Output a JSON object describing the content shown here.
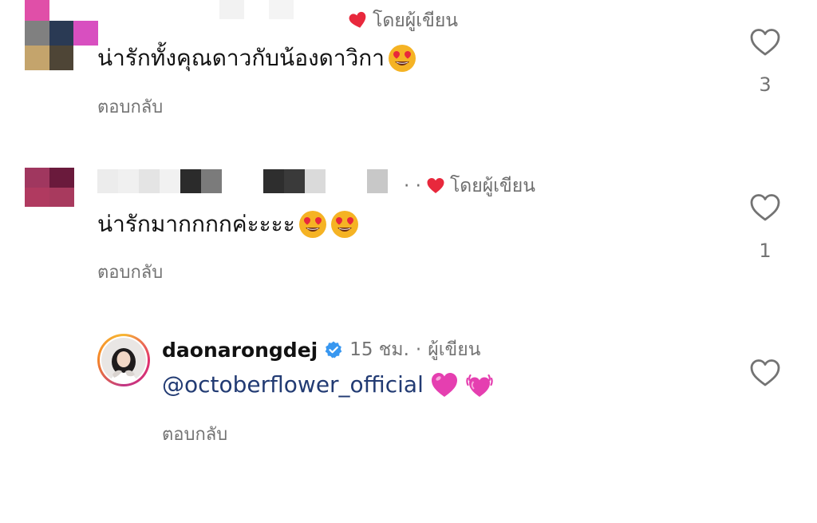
{
  "comments": [
    {
      "avatar_pixels": [
        "#e04fa8",
        "#ffffff",
        "#ffffff",
        "#808080",
        "#2a3a54",
        "#d84fc0",
        "#c4a46c",
        "#4e4536",
        "#ffffff"
      ],
      "name_pixels": [
        "#f2f2f2",
        "#ffffff",
        "#f4f4f4"
      ],
      "liked_by_author": "โดยผู้เขียน",
      "text": "น่ารักทั้งคุณดาวกับน้องดาวิกา",
      "emojis": [
        "heart-eyes"
      ],
      "reply_label": "ตอบกลับ",
      "like_count": "3"
    },
    {
      "avatar_pixels": [
        "#a0375f",
        "#6a1a3c",
        "#b03a60",
        "#a83a5e",
        "#ffffff",
        "#ffffff"
      ],
      "name_pixels": [
        "#ececec",
        "#f0f0f0",
        "#e4e4e4",
        "#f1f1f1",
        "#2b2b2b",
        "#7b7b7b",
        "#ffffff",
        "#ffffff",
        "#2e2e2e",
        "#3a3a3a",
        "#dadada",
        "#ffffff",
        "#ffffff",
        "#c8c8c8"
      ],
      "separator": "· ·",
      "liked_by_author": "โดยผู้เขียน",
      "text": "น่ารักมากกกกค่ะะะะ",
      "emojis": [
        "heart-eyes",
        "heart-eyes"
      ],
      "reply_label": "ตอบกลับ",
      "like_count": "1"
    }
  ],
  "author_reply": {
    "username": "daonarongdej",
    "time": "15 ชม.",
    "separator": "·",
    "role": "ผู้เขียน",
    "mention": "@octoberflower_official",
    "emojis": [
      "pink-heart",
      "beating-heart"
    ],
    "reply_label": "ตอบกลับ"
  },
  "icons": {
    "like": "heart-outline-icon",
    "liked_by_author": "red-heart-icon",
    "verified": "verified-badge-icon"
  },
  "colors": {
    "red_heart": "#e8283c",
    "verified_blue": "#3897f0",
    "mention_blue": "#223b73",
    "secondary_text": "#737373",
    "heart_eyes_face": "#f5b324",
    "pink_heart": "#e53fb0"
  }
}
